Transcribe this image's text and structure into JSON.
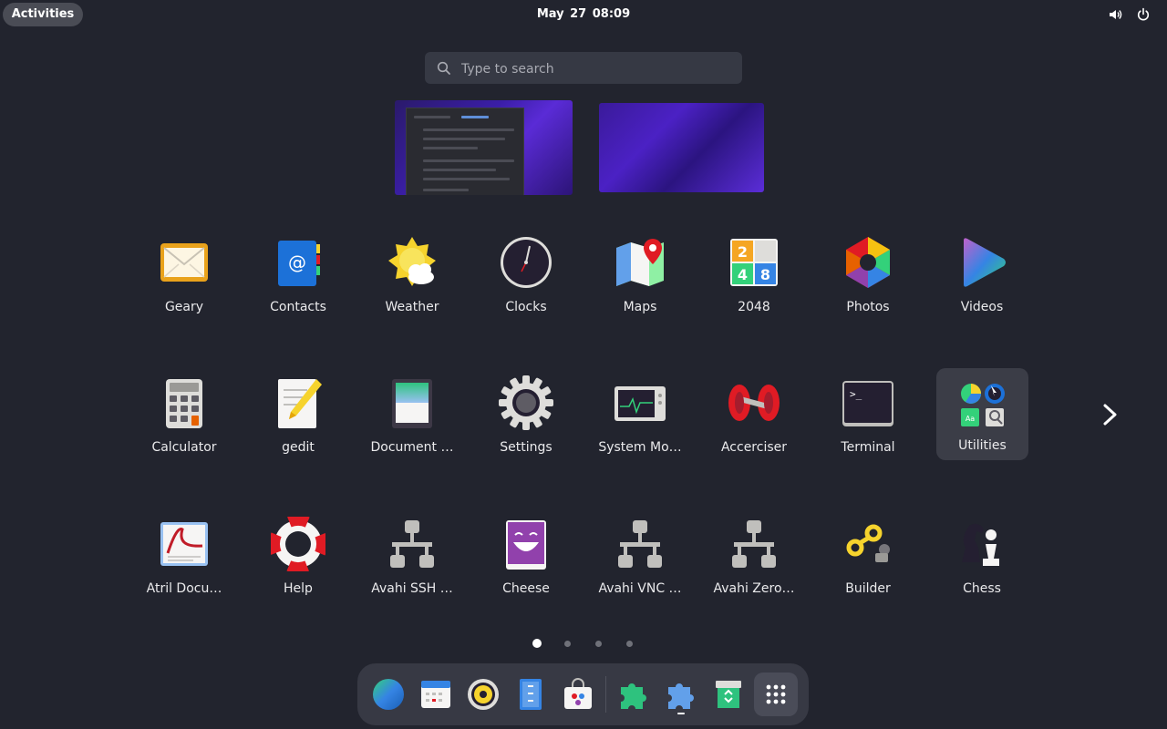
{
  "topbar": {
    "activities_label": "Activities",
    "date": "May 27",
    "time": "08:09",
    "tray": [
      "volume-icon",
      "power-icon"
    ]
  },
  "search": {
    "placeholder": "Type to search",
    "value": ""
  },
  "workspaces": [
    {
      "id": "workspace-1"
    },
    {
      "id": "workspace-2"
    }
  ],
  "apps": {
    "row1": [
      {
        "label": "Geary",
        "icon": "geary-icon"
      },
      {
        "label": "Contacts",
        "icon": "contacts-icon"
      },
      {
        "label": "Weather",
        "icon": "weather-icon"
      },
      {
        "label": "Clocks",
        "icon": "clocks-icon"
      },
      {
        "label": "Maps",
        "icon": "maps-icon"
      },
      {
        "label": "2048",
        "icon": "game-2048-icon",
        "tiles": [
          "2",
          "4",
          "8"
        ]
      },
      {
        "label": "Photos",
        "icon": "photos-icon"
      },
      {
        "label": "Videos",
        "icon": "videos-icon"
      }
    ],
    "row2": [
      {
        "label": "Calculator",
        "icon": "calculator-icon"
      },
      {
        "label": "gedit",
        "icon": "gedit-icon"
      },
      {
        "label": "Document …",
        "icon": "document-scanner-icon"
      },
      {
        "label": "Settings",
        "icon": "settings-icon"
      },
      {
        "label": "System Mo…",
        "icon": "system-monitor-icon"
      },
      {
        "label": "Accerciser",
        "icon": "accerciser-icon"
      },
      {
        "label": "Terminal",
        "icon": "terminal-icon",
        "prompt": ">_"
      },
      {
        "label": "Utilities",
        "icon": "utilities-folder-icon"
      }
    ],
    "row3": [
      {
        "label": "Atril Docu…",
        "icon": "atril-icon"
      },
      {
        "label": "Help",
        "icon": "help-icon"
      },
      {
        "label": "Avahi SSH …",
        "icon": "avahi-ssh-icon"
      },
      {
        "label": "Cheese",
        "icon": "cheese-icon"
      },
      {
        "label": "Avahi VNC …",
        "icon": "avahi-vnc-icon"
      },
      {
        "label": "Avahi Zero…",
        "icon": "avahi-zeroconf-icon"
      },
      {
        "label": "Builder",
        "icon": "builder-icon"
      },
      {
        "label": "Chess",
        "icon": "chess-icon"
      }
    ]
  },
  "pagination": {
    "pages": 4,
    "current": 1
  },
  "dock": [
    {
      "name": "web-browser",
      "icon": "globe-icon"
    },
    {
      "name": "calendar",
      "icon": "calendar-icon"
    },
    {
      "name": "music-player",
      "icon": "speaker-icon"
    },
    {
      "name": "file-manager",
      "icon": "files-icon"
    },
    {
      "name": "software",
      "icon": "software-store-icon"
    },
    {
      "name": "extensions",
      "icon": "puzzle-green-icon"
    },
    {
      "name": "extension-manager",
      "icon": "puzzle-blue-icon",
      "running": true
    },
    {
      "name": "trash",
      "icon": "recycle-icon"
    },
    {
      "name": "show-apps",
      "icon": "grid-icon",
      "active": true
    }
  ],
  "colors": {
    "background": "#22242e",
    "panel": "#373944",
    "accent": "#3584e4"
  }
}
